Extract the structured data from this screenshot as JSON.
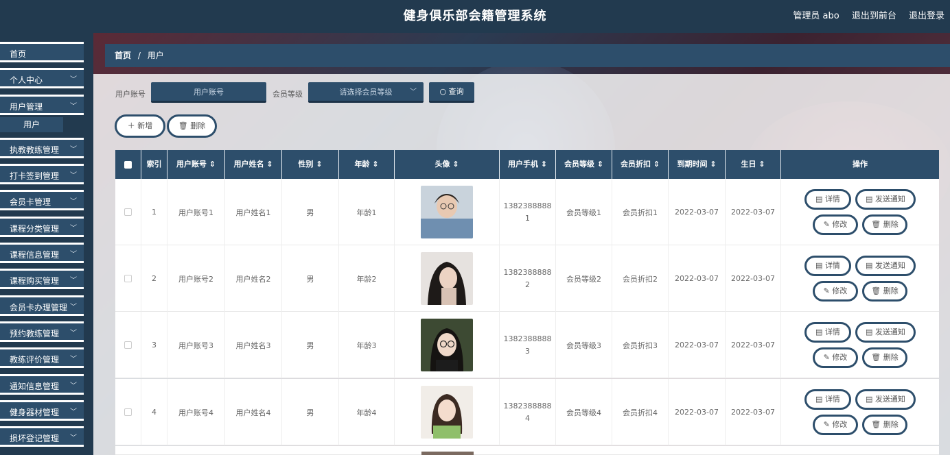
{
  "header": {
    "title": "健身俱乐部会籍管理系统",
    "admin": "管理员 abo",
    "to_front": "退出到前台",
    "logout": "退出登录"
  },
  "sidebar": {
    "items": [
      {
        "label": "首页",
        "chevron": false
      },
      {
        "label": "个人中心",
        "chevron": true
      },
      {
        "label": "用户管理",
        "chevron": true
      },
      {
        "label": "执教教练管理",
        "chevron": true
      },
      {
        "label": "打卡签到管理",
        "chevron": true
      },
      {
        "label": "会员卡管理",
        "chevron": true
      },
      {
        "label": "课程分类管理",
        "chevron": true
      },
      {
        "label": "课程信息管理",
        "chevron": true
      },
      {
        "label": "课程购买管理",
        "chevron": true
      },
      {
        "label": "会员卡办理管理",
        "chevron": true
      },
      {
        "label": "预约教练管理",
        "chevron": true
      },
      {
        "label": "教练评价管理",
        "chevron": true
      },
      {
        "label": "通知信息管理",
        "chevron": true
      },
      {
        "label": "健身器材管理",
        "chevron": true
      },
      {
        "label": "损坏登记管理",
        "chevron": true
      }
    ],
    "sub_item": "用户"
  },
  "breadcrumb": {
    "home": "首页",
    "sep": "/",
    "current": "用户"
  },
  "search": {
    "account_label": "用户账号",
    "account_placeholder": "用户账号",
    "level_label": "会员等级",
    "level_placeholder": "请选择会员等级",
    "query_label": "查询"
  },
  "actions": {
    "add": "新增",
    "delete": "删除"
  },
  "table": {
    "columns": [
      "",
      "索引",
      "用户账号 ⇕",
      "用户姓名 ⇕",
      "性别 ⇕",
      "年龄 ⇕",
      "头像 ⇕",
      "用户手机 ⇕",
      "会员等级 ⇕",
      "会员折扣 ⇕",
      "到期时间 ⇕",
      "生日 ⇕",
      "操作"
    ],
    "rows": [
      {
        "index": "1",
        "account": "用户账号1",
        "name": "用户姓名1",
        "gender": "男",
        "age": "年龄1",
        "phone": "1382388888 1",
        "level": "会员等级1",
        "discount": "会员折扣1",
        "expire": "2022-03-07",
        "birthday": "2022-03-07"
      },
      {
        "index": "2",
        "account": "用户账号2",
        "name": "用户姓名2",
        "gender": "男",
        "age": "年龄2",
        "phone": "1382388888 2",
        "level": "会员等级2",
        "discount": "会员折扣2",
        "expire": "2022-03-07",
        "birthday": "2022-03-07"
      },
      {
        "index": "3",
        "account": "用户账号3",
        "name": "用户姓名3",
        "gender": "男",
        "age": "年龄3",
        "phone": "1382388888 3",
        "level": "会员等级3",
        "discount": "会员折扣3",
        "expire": "2022-03-07",
        "birthday": "2022-03-07"
      },
      {
        "index": "4",
        "account": "用户账号4",
        "name": "用户姓名4",
        "gender": "男",
        "age": "年龄4",
        "phone": "1382388888 4",
        "level": "会员等级4",
        "discount": "会员折扣4",
        "expire": "2022-03-07",
        "birthday": "2022-03-07"
      }
    ],
    "ops": {
      "detail": "详情",
      "notify": "发送通知",
      "edit": "修改",
      "delete": "删除"
    }
  },
  "colors": {
    "primary": "#2d4e6b",
    "topbar": "#223a4f"
  }
}
